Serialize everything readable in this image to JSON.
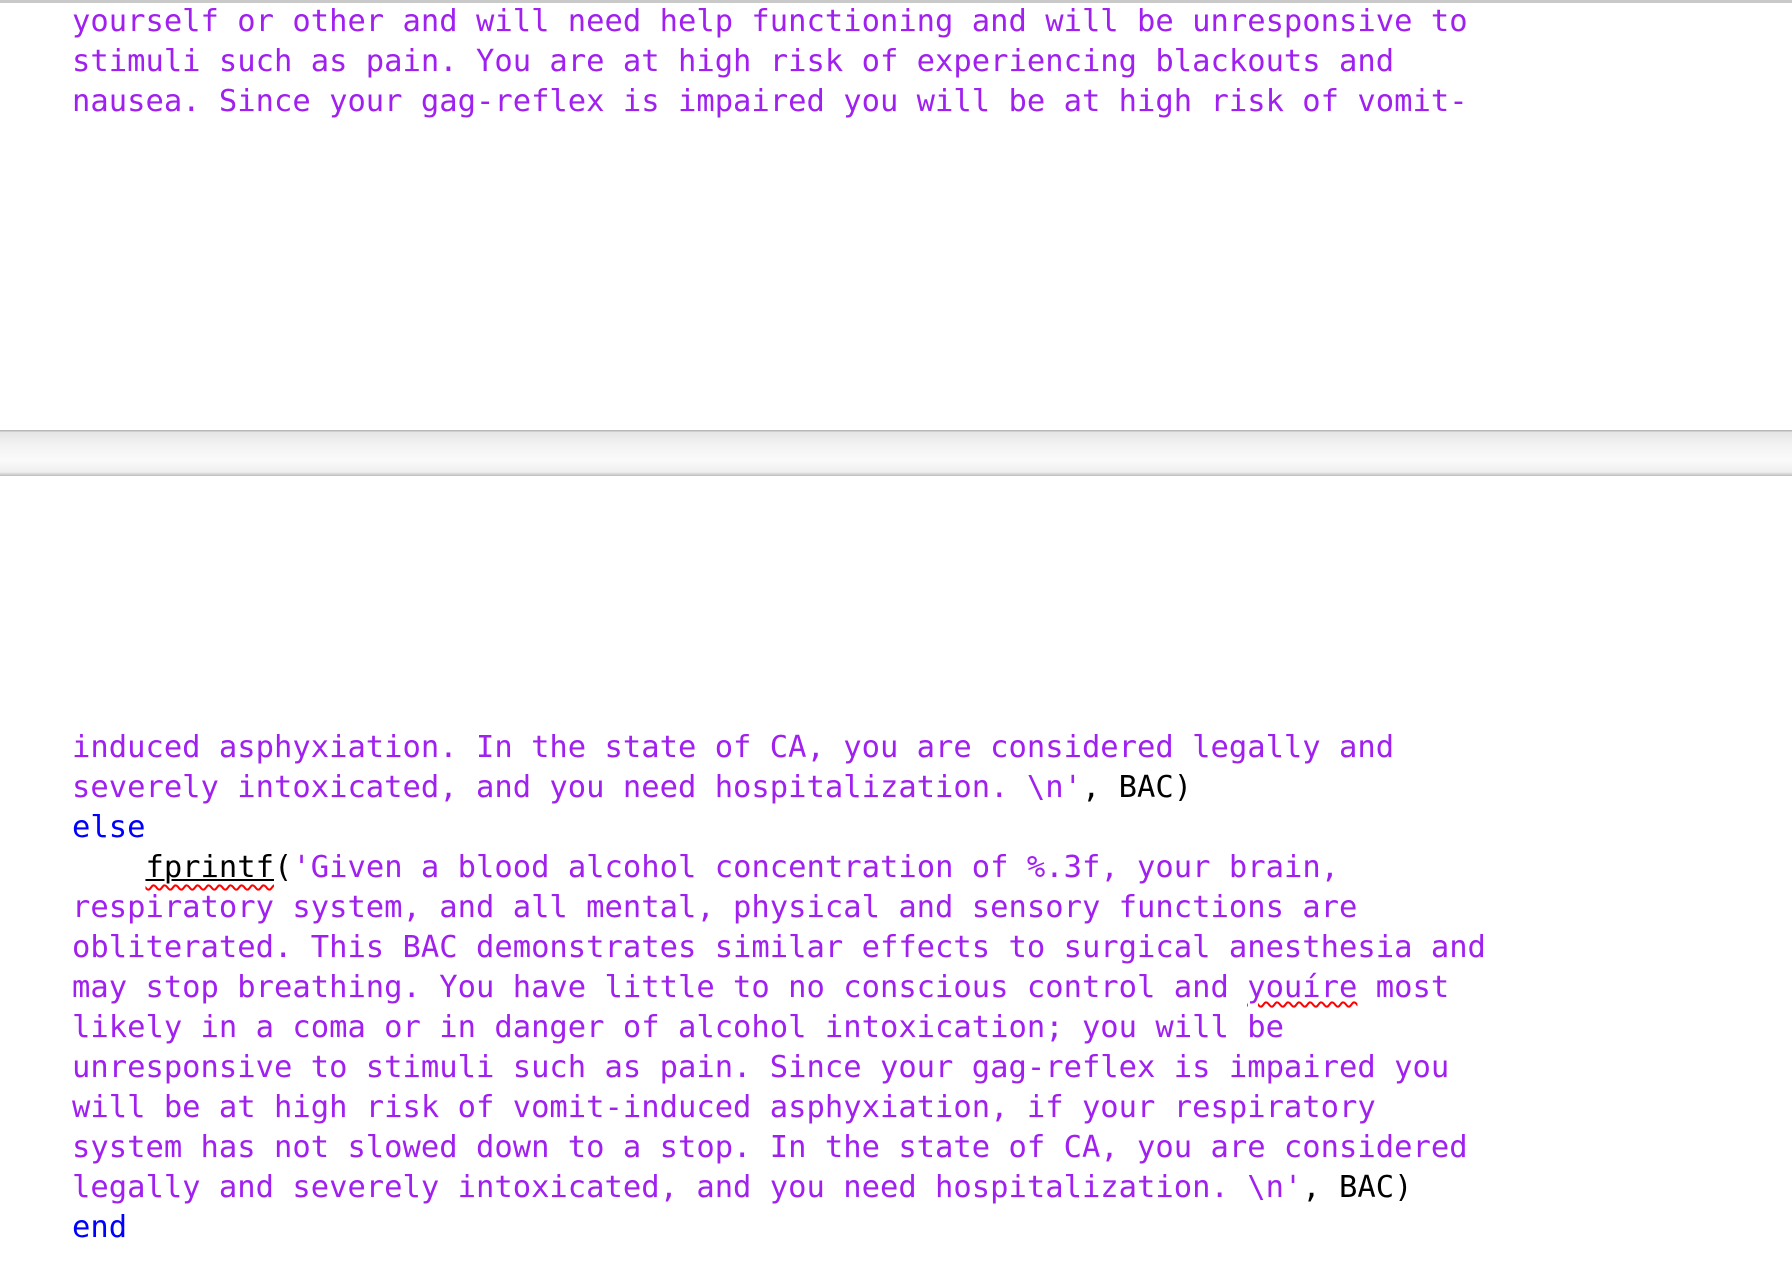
{
  "document": {
    "type": "matlab-source-code-printout",
    "language": "MATLAB",
    "colors": {
      "string": "#a020f0",
      "keyword": "#0000ff",
      "plain": "#000000",
      "spellcheck_underline": "#ff0000",
      "separator_bar": "#f2f2f2",
      "separator_border": "#b7b7b7",
      "page_background": "#ffffff",
      "top_rule": "#c9c9c9"
    }
  },
  "top_block": {
    "lines": [
      {
        "id": "top-line-1",
        "segments": [
          {
            "kind": "string",
            "text": "yourself or other and will need help functioning and will be unresponsive to"
          }
        ]
      },
      {
        "id": "top-line-2",
        "segments": [
          {
            "kind": "string",
            "text": "stimuli such as pain. You are at high risk of experiencing blackouts and"
          }
        ]
      },
      {
        "id": "top-line-3",
        "segments": [
          {
            "kind": "string",
            "text": "nausea. Since your gag-reflex is impaired you will be at high risk of vomit-"
          }
        ]
      }
    ]
  },
  "separator": {
    "name": "page-break-separator",
    "label": ""
  },
  "bottom_block": {
    "lines": [
      {
        "id": "bot-line-1",
        "segments": [
          {
            "kind": "string",
            "text": "induced asphyxiation. In the state of CA, you are considered legally and"
          }
        ]
      },
      {
        "id": "bot-line-2",
        "segments": [
          {
            "kind": "string",
            "text": "severely intoxicated, and you need hospitalization. \\n'"
          },
          {
            "kind": "plain",
            "text": ", BAC)"
          }
        ]
      },
      {
        "id": "bot-line-3",
        "segments": [
          {
            "kind": "keyword",
            "text": "else"
          }
        ]
      },
      {
        "id": "bot-line-4",
        "segments": [
          {
            "kind": "indent",
            "text": "    "
          },
          {
            "kind": "function-name",
            "text": "fprintf"
          },
          {
            "kind": "plain",
            "text": "("
          },
          {
            "kind": "string",
            "text": "'Given a blood alcohol concentration of %.3f, your brain,"
          }
        ]
      },
      {
        "id": "bot-line-5",
        "segments": [
          {
            "kind": "string",
            "text": "respiratory system, and all mental, physical and sensory functions are"
          }
        ]
      },
      {
        "id": "bot-line-6",
        "segments": [
          {
            "kind": "string",
            "text": "obliterated. This BAC demonstrates similar effects to surgical anesthesia and"
          }
        ]
      },
      {
        "id": "bot-line-7",
        "segments": [
          {
            "kind": "string",
            "text": "may stop breathing. You have little to no conscious control and "
          },
          {
            "kind": "misspelled-string",
            "text": "youíre"
          },
          {
            "kind": "string",
            "text": " most"
          }
        ]
      },
      {
        "id": "bot-line-8",
        "segments": [
          {
            "kind": "string",
            "text": "likely in a coma or in danger of alcohol intoxication; you will be"
          }
        ]
      },
      {
        "id": "bot-line-9",
        "segments": [
          {
            "kind": "string",
            "text": "unresponsive to stimuli such as pain. Since your gag-reflex is impaired you"
          }
        ]
      },
      {
        "id": "bot-line-10",
        "segments": [
          {
            "kind": "string",
            "text": "will be at high risk of vomit-induced asphyxiation, if your respiratory"
          }
        ]
      },
      {
        "id": "bot-line-11",
        "segments": [
          {
            "kind": "string",
            "text": "system has not slowed down to a stop. In the state of CA, you are considered"
          }
        ]
      },
      {
        "id": "bot-line-12",
        "segments": [
          {
            "kind": "string",
            "text": "legally and severely intoxicated, and you need hospitalization. \\n'"
          },
          {
            "kind": "plain",
            "text": ", BAC)"
          }
        ]
      },
      {
        "id": "bot-line-13",
        "segments": [
          {
            "kind": "keyword",
            "text": "end"
          }
        ]
      }
    ]
  }
}
